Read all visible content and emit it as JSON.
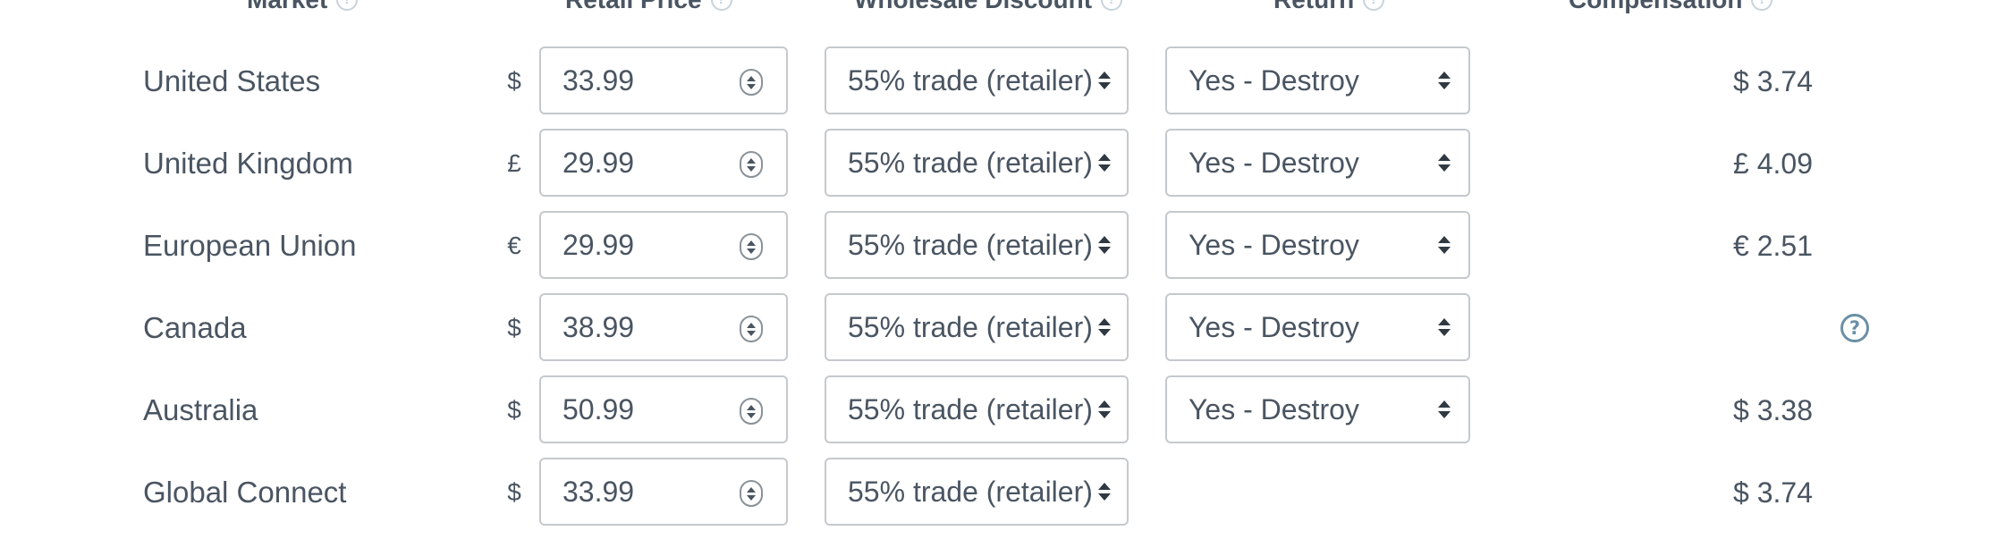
{
  "headers": {
    "market": "Market",
    "retail_price": "Retail Price",
    "wholesale_discount": "Wholesale Discount",
    "return": "Return",
    "compensation": "Compensation"
  },
  "help_glyph": "?",
  "rows": [
    {
      "market": "United States",
      "currency": "$",
      "price": "33.99",
      "discount": "55% trade (retailer)",
      "return": "Yes - Destroy",
      "compensation": "$ 3.74"
    },
    {
      "market": "United Kingdom",
      "currency": "£",
      "price": "29.99",
      "discount": "55% trade (retailer)",
      "return": "Yes - Destroy",
      "compensation": "£ 4.09"
    },
    {
      "market": "European Union",
      "currency": "€",
      "price": "29.99",
      "discount": "55% trade (retailer)",
      "return": "Yes - Destroy",
      "compensation": "€ 2.51"
    },
    {
      "market": "Canada",
      "currency": "$",
      "price": "38.99",
      "discount": "55% trade (retailer)",
      "return": "Yes - Destroy",
      "compensation": ""
    },
    {
      "market": "Australia",
      "currency": "$",
      "price": "50.99",
      "discount": "55% trade (retailer)",
      "return": "Yes - Destroy",
      "compensation": "$ 3.38"
    },
    {
      "market": "Global Connect",
      "currency": "$",
      "price": "33.99",
      "discount": "55% trade (retailer)",
      "return": "",
      "compensation": "$ 3.74"
    }
  ]
}
